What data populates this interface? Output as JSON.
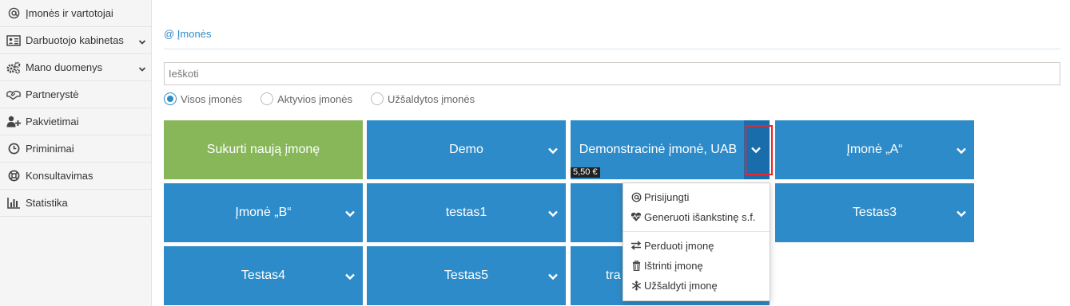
{
  "sidebar": {
    "items": [
      {
        "label": "Įmonės ir vartotojai",
        "icon": "at-icon",
        "has_chevron": false
      },
      {
        "label": "Darbuotojo kabinetas",
        "icon": "id-card-icon",
        "has_chevron": true
      },
      {
        "label": "Mano duomenys",
        "icon": "gears-icon",
        "has_chevron": true
      },
      {
        "label": "Partnerystė",
        "icon": "handshake-icon",
        "has_chevron": false
      },
      {
        "label": "Pakvietimai",
        "icon": "user-plus-icon",
        "has_chevron": false
      },
      {
        "label": "Priminimai",
        "icon": "clock-icon",
        "has_chevron": false
      },
      {
        "label": "Konsultavimas",
        "icon": "life-ring-icon",
        "has_chevron": false
      },
      {
        "label": "Statistika",
        "icon": "bar-chart-icon",
        "has_chevron": false
      }
    ]
  },
  "breadcrumb": {
    "label": "@ Įmonės"
  },
  "search": {
    "placeholder": "Ieškoti",
    "value": ""
  },
  "filters": {
    "options": [
      "Visos įmonės",
      "Aktyvios įmonės",
      "Užšaldytos įmonės"
    ],
    "selected": "Visos įmonės"
  },
  "tiles": [
    {
      "label": "Sukurti naują įmonę"
    },
    {
      "label": "Demo"
    },
    {
      "label": "Demonstracinė įmonė, UAB"
    },
    {
      "label": "Įmonė „A“"
    },
    {
      "label": "Įmonė „B“"
    },
    {
      "label": "testas1"
    },
    {
      "label": ""
    },
    {
      "label": "Testas3"
    },
    {
      "label": "Testas4"
    },
    {
      "label": "Testas5"
    },
    {
      "label": "tra"
    }
  ],
  "price_badge": "5,50 €",
  "dropdown": {
    "items": [
      {
        "label": "Prisijungti",
        "icon": "at-icon"
      },
      {
        "label": "Generuoti išankstinę s.f.",
        "icon": "heartbeat-icon"
      },
      {
        "label": "Perduoti įmonę",
        "icon": "exchange-icon"
      },
      {
        "label": "Ištrinti įmonę",
        "icon": "trash-icon"
      },
      {
        "label": "Užšaldyti įmonę",
        "icon": "snowflake-icon"
      }
    ]
  },
  "colors": {
    "primary": "#2e8bc9",
    "create": "#88b75a",
    "highlight": "#e8262b"
  }
}
